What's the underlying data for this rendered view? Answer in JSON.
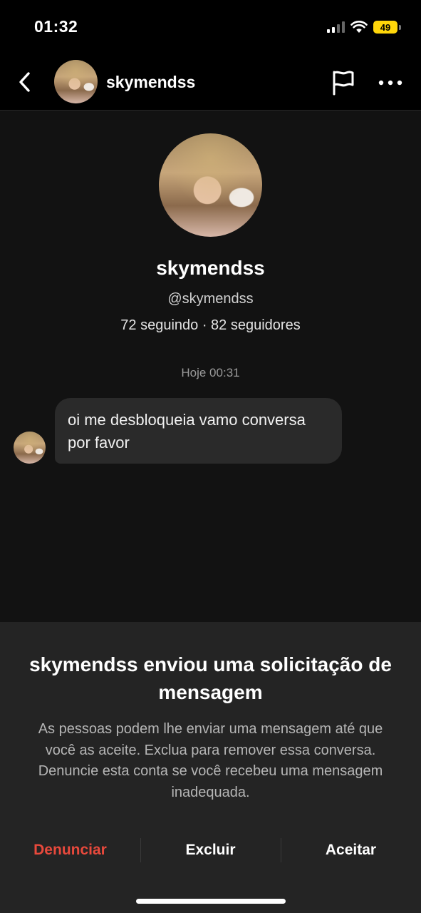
{
  "status_bar": {
    "time": "01:32",
    "battery": "49",
    "battery_color": "#ffd60a",
    "icons": [
      "cellular-signal-icon",
      "wifi-icon",
      "battery-icon"
    ]
  },
  "header": {
    "username": "skymendss",
    "icons": [
      "chevron-left-icon",
      "flag-icon",
      "more-horizontal-icon"
    ]
  },
  "profile": {
    "name": "skymendss",
    "handle": "@skymendss",
    "stats": "72 seguindo · 82 seguidores"
  },
  "conversation": {
    "timestamp": "Hoje 00:31",
    "messages": [
      {
        "text": "oi me desbloqueia vamo conversa por favor"
      }
    ]
  },
  "request": {
    "title": "skymendss enviou uma solicitação de mensagem",
    "body": "As pessoas podem lhe enviar uma mensagem até que você as aceite. Exclua para remover essa conversa. Denuncie esta conta se você recebeu uma mensagem inadequada.",
    "actions": {
      "report": "Denunciar",
      "delete": "Excluir",
      "accept": "Aceitar"
    },
    "report_color": "#e8493c"
  }
}
